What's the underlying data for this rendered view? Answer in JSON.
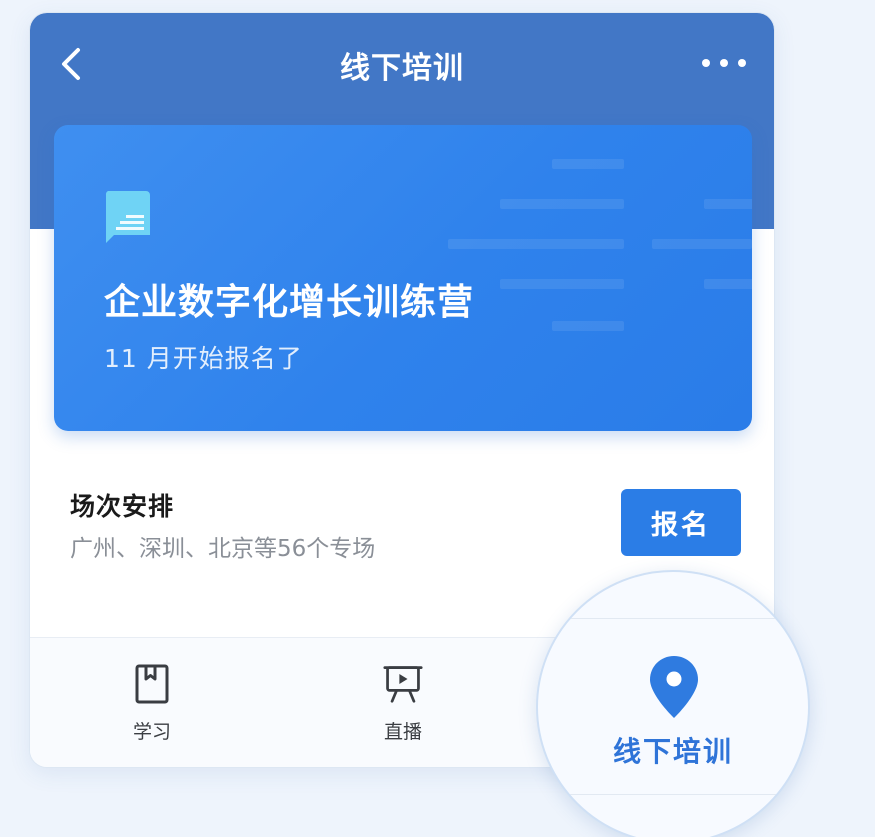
{
  "header": {
    "title": "线下培训",
    "back_icon": "chevron-left-icon",
    "more_icon": "more-horizontal-icon",
    "color": "#4277c6"
  },
  "banner": {
    "icon": "document-chat-icon",
    "title": "企业数字化增长训练营",
    "subtitle": "11 月开始报名了",
    "color": "#2f82ec"
  },
  "schedule": {
    "title": "场次安排",
    "description": "广州、深圳、北京等56个专场",
    "signup_label": "报名",
    "button_color": "#2b7de6"
  },
  "tabbar": {
    "tabs": [
      {
        "label": "学习",
        "icon": "book-icon",
        "active": false
      },
      {
        "label": "直播",
        "icon": "live-presentation-icon",
        "active": false
      },
      {
        "label": "线下培训",
        "icon": "location-pin-icon",
        "active": true
      }
    ],
    "active_color": "#2f74d8"
  }
}
